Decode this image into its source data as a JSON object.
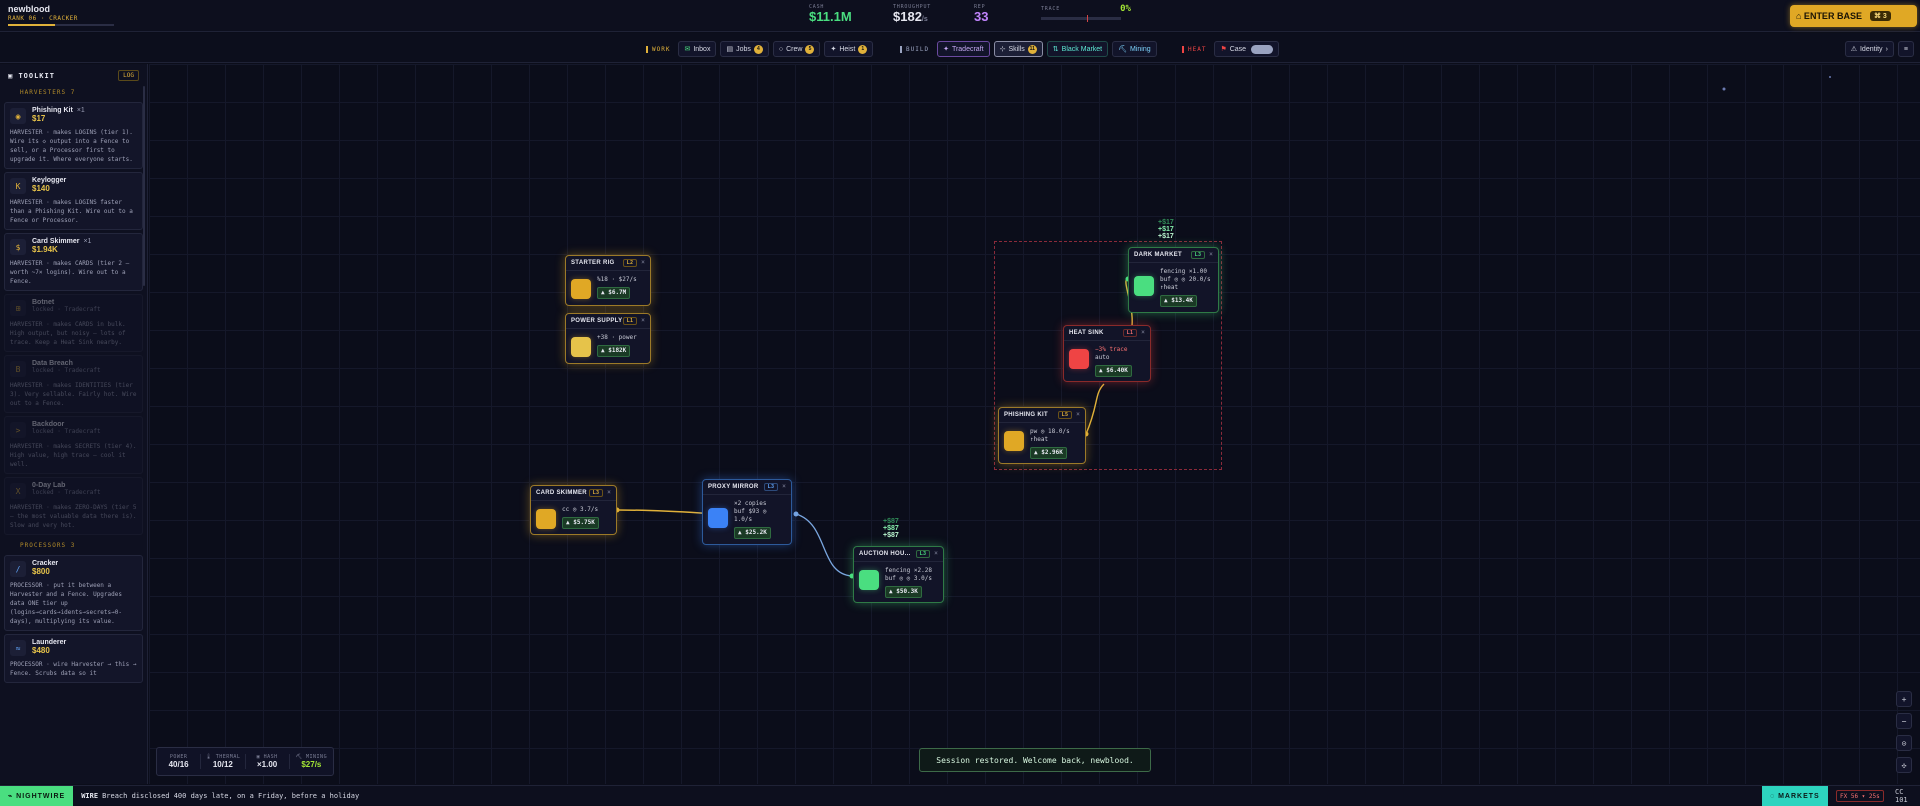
{
  "brand": {
    "name": "newblood",
    "rank": "RANK 06 · CRACKER",
    "rank_progress": 0.44
  },
  "stats": {
    "cash": {
      "label": "CASH",
      "value": "$11.1M"
    },
    "throughput": {
      "label": "THROUGHPUT",
      "value": "$182",
      "unit": "/s"
    },
    "rep": {
      "label": "REP",
      "value": "33"
    },
    "trace": {
      "label": "TRACE",
      "value": "0%"
    }
  },
  "enter_base": {
    "label": "⌂ ENTER BASE",
    "badge": "⌘ 3"
  },
  "tabs": {
    "work_label": "WORK",
    "inbox": "Inbox",
    "jobs": "Jobs",
    "jobs_count": "4",
    "crew": "Crew",
    "crew_count": "5",
    "heist": "Heist",
    "heist_count": "1",
    "build_label": "BUILD",
    "tradecraft": "Tradecraft",
    "skills": "Skills",
    "skills_count": "11",
    "black_market": "Black Market",
    "mining": "Mining",
    "heat_label": "HEAT",
    "case": "Case",
    "identity": "Identity"
  },
  "sidebar": {
    "title": "TOOLKIT",
    "log": "LOG",
    "harvesters_label": "HARVESTERS 7",
    "processors_label": "PROCESSORS 3",
    "items": [
      {
        "name": "Phishing Kit",
        "count": "×1",
        "price": "$17",
        "desc": "HARVESTER · makes LOGINS (tier 1). Wire its ◇ output into a Fence to sell, or a Processor first to upgrade it. Where everyone starts."
      },
      {
        "name": "Keylogger",
        "count": "",
        "price": "$140",
        "desc": "HARVESTER · makes LOGINS faster than a Phishing Kit. Wire out to a Fence or Processor."
      },
      {
        "name": "Card Skimmer",
        "count": "×1",
        "price": "$1.94K",
        "desc": "HARVESTER · makes CARDS (tier 2 — worth ~7× logins). Wire out to a Fence."
      },
      {
        "name": "Botnet",
        "sub": "locked · Tradecraft",
        "desc": "HARVESTER · makes CARDS in bulk. High output, but noisy — lots of trace. Keep a Heat Sink nearby."
      },
      {
        "name": "Data Breach",
        "sub": "locked · Tradecraft",
        "desc": "HARVESTER · makes IDENTITIES (tier 3). Very sellable. Fairly hot. Wire out to a Fence."
      },
      {
        "name": "Backdoor",
        "sub": "locked · Tradecraft",
        "desc": "HARVESTER · makes SECRETS (tier 4). High value, high trace — cool it well."
      },
      {
        "name": "0-Day Lab",
        "sub": "locked · Tradecraft",
        "desc": "HARVESTER · makes ZERO-DAYS (tier 5 — the most valuable data there is). Slow and very hot."
      },
      {
        "name": "Cracker",
        "count": "",
        "price": "$800",
        "desc": "PROCESSOR · put it between a Harvester and a Fence. Upgrades data ONE tier up (logins→cards→idents→secrets→0-days), multiplying its value."
      },
      {
        "name": "Launderer",
        "count": "",
        "price": "$480",
        "desc": "PROCESSOR · wire Harvester → this → Fence. Scrubs data so it"
      }
    ]
  },
  "nodes": {
    "starter_rig": {
      "title": "STARTER RIG",
      "lv": "L2",
      "line1": "%18 · $27/s",
      "up": "▲ $6.7M"
    },
    "power_supply": {
      "title": "POWER SUPPLY",
      "lv": "L1",
      "line1": "+38 · power",
      "up": "▲ $182K"
    },
    "card_skimmer": {
      "title": "CARD SKIMMER",
      "lv": "L3",
      "line1": "cc ◎ 3.7/s",
      "up": "▲ $5.75K"
    },
    "proxy_mirror": {
      "title": "PROXY MIRROR",
      "lv": "L3",
      "line1": "×2 copies",
      "line2": "buf $93 ◎",
      "line3": "1.0/s",
      "up": "▲ $25.2K"
    },
    "auction_house": {
      "title": "AUCTION HOU...",
      "lv": "L3",
      "line1": "fencing ×2.28",
      "line2": "buf ◎ ◎ 3.0/s",
      "up": "▲ $50.3K"
    },
    "dark_market": {
      "title": "DARK MARKET",
      "lv": "L3",
      "line1": "fencing ×1.00",
      "line2": "buf ◎ ◎ 20.0/s",
      "line3": "↑heat",
      "up": "▲ $13.4K"
    },
    "heat_sink": {
      "title": "HEAT SINK",
      "lv": "L1",
      "line1": "−3% trace",
      "line2": "auto",
      "up": "▲ $6.40K"
    },
    "phishing_kit": {
      "title": "PHISHING KIT",
      "lv": "L5",
      "line1": "pw ◎ 18.0/s",
      "line2": "↑heat",
      "up": "▲ $2.96K"
    }
  },
  "floats": {
    "dm": [
      "+$17",
      "+$17",
      "+$17"
    ],
    "ah": [
      "+$87",
      "+$87",
      "+$87"
    ]
  },
  "statbox": {
    "power": {
      "label": "POWER",
      "value": "40/16"
    },
    "thermal": {
      "label": "THERMAL",
      "value": "10/12"
    },
    "hash": {
      "label": "HASH",
      "value": "×1.00"
    },
    "mining": {
      "label": "MINING",
      "value": "$27/s"
    }
  },
  "toast": "Session restored. Welcome back, newblood.",
  "zoom": {
    "in": "+",
    "out": "−",
    "fit": "⊙",
    "center": "✣"
  },
  "bottom": {
    "nightwire": "⌁ NIGHTWIRE",
    "wire_tag": "WIRE",
    "wire_text": "Breach disclosed 400 days late, on a Friday, before a holiday",
    "markets": "◌ MARKETS",
    "fx": "FX 56 ▾ 25s",
    "cc": "CC 101"
  },
  "colors": {
    "gold": "#e0b13a",
    "green": "#4ade80",
    "blue": "#60a5fa",
    "red": "#f87171",
    "teal": "#2dd4bf"
  }
}
